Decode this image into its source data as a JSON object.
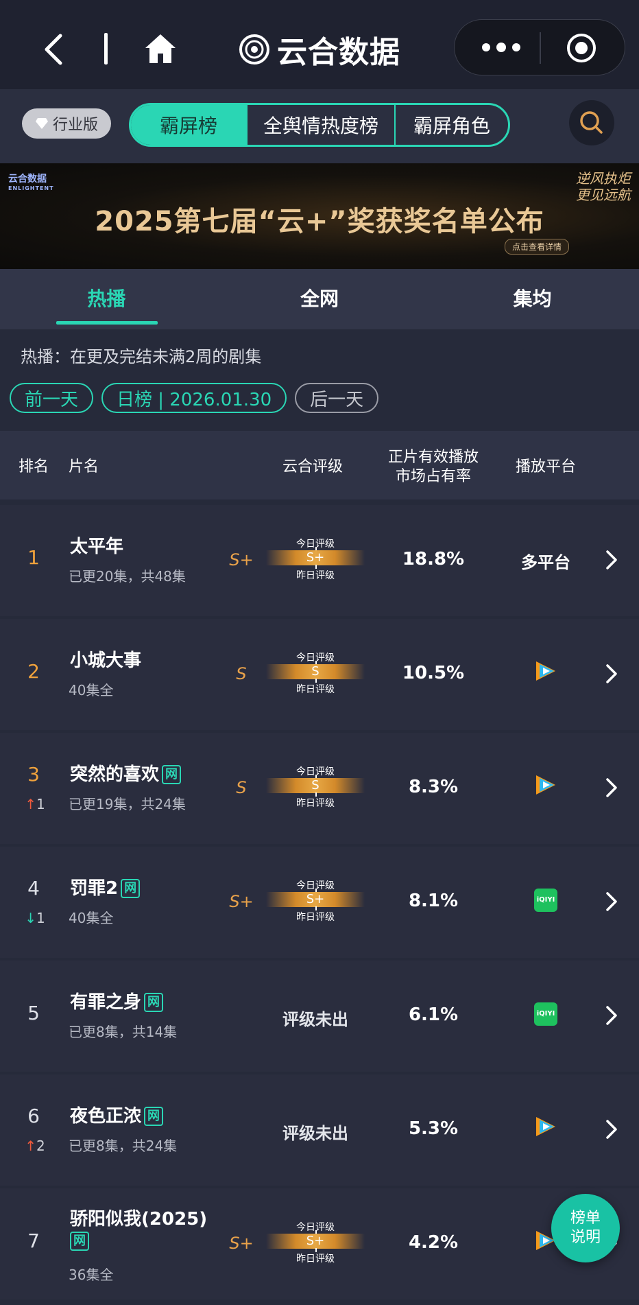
{
  "app": {
    "title": "云合数据"
  },
  "subheader": {
    "industry_badge": "行业版",
    "segments": [
      "霸屏榜",
      "全舆情热度榜",
      "霸屏角色"
    ]
  },
  "banner": {
    "title": "2025第七届“云+”奖获奖名单公布",
    "brand": "云合数据",
    "brand_en": "ENLIGHTENT",
    "slogan": "逆风执炬 更见远航",
    "cta": "点击查看详情"
  },
  "tabs": [
    "热播",
    "全网",
    "集均"
  ],
  "description": "热播：在更及完结未满2周的剧集",
  "date_bar": {
    "prev": "前一天",
    "current": "日榜 | 2026.01.30",
    "next": "后一天"
  },
  "columns": {
    "rank": "排名",
    "title": "片名",
    "rating": "云合评级",
    "share_line1": "正片有效播放",
    "share_line2": "市场占有率",
    "platform": "播放平台"
  },
  "rating_labels": {
    "today": "今日评级",
    "yesterday": "昨日评级",
    "unrated": "评级未出"
  },
  "rows": [
    {
      "rank": "1",
      "change": "",
      "title": "太平年",
      "net": "",
      "episodes": "已更20集，共48集",
      "grade": "S+",
      "grade_today": "S+",
      "share": "18.8%",
      "platform": "多平台"
    },
    {
      "rank": "2",
      "change": "",
      "title": "小城大事",
      "net": "",
      "episodes": "40集全",
      "grade": "S",
      "grade_today": "S",
      "share": "10.5%",
      "platform": "tencent-video-icon"
    },
    {
      "rank": "3",
      "change": "↑1",
      "title": "突然的喜欢",
      "net": "网",
      "episodes": "已更19集，共24集",
      "grade": "S",
      "grade_today": "S",
      "share": "8.3%",
      "platform": "tencent-video-icon"
    },
    {
      "rank": "4",
      "change": "↓1",
      "title": "罚罪2",
      "net": "网",
      "episodes": "40集全",
      "grade": "S+",
      "grade_today": "S+",
      "share": "8.1%",
      "platform": "iqiyi-icon"
    },
    {
      "rank": "5",
      "change": "",
      "title": "有罪之身",
      "net": "网",
      "episodes": "已更8集，共14集",
      "grade": "",
      "grade_today": "",
      "share": "6.1%",
      "platform": "iqiyi-icon"
    },
    {
      "rank": "6",
      "change": "↑2",
      "title": "夜色正浓",
      "net": "网",
      "episodes": "已更8集，共24集",
      "grade": "",
      "grade_today": "",
      "share": "5.3%",
      "platform": "tencent-video-icon"
    },
    {
      "rank": "7",
      "change": "",
      "title": "骄阳似我(2025)",
      "net": "网",
      "episodes": "36集全",
      "grade": "S+",
      "grade_today": "S+",
      "share": "4.2%",
      "platform": "tencent-video-icon"
    }
  ],
  "iqiyi_text": "iQIYI",
  "float_button": {
    "line1": "榜单",
    "line2": "说明"
  },
  "colors": {
    "accent": "#2ad6b4",
    "rank_top": "#f0a23c",
    "grade": "#e9a24a",
    "up": "#f05a3c",
    "down": "#2ad6b4"
  }
}
